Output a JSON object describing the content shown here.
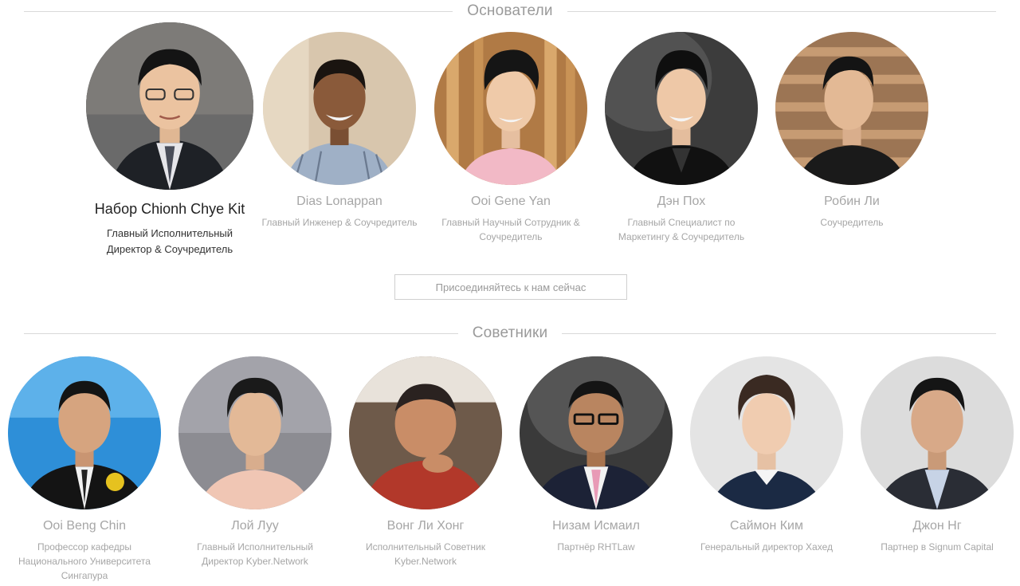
{
  "sections": {
    "founders_title": "Основатели",
    "advisors_title": "Советники"
  },
  "founders": [
    {
      "name": "Набор Chionh Chye Kit",
      "role": "Главный Исполнительный Директор & Соучредитель"
    },
    {
      "name": "Dias Lonappan",
      "role": "Главный Инженер & Соучредитель"
    },
    {
      "name": "Ooi Gene Yan",
      "role": "Главный Научный Сотрудник & Соучредитель"
    },
    {
      "name": "Дэн Пох",
      "role": "Главный Специалист по Маркетингу & Соучредитель"
    },
    {
      "name": "Робин Ли",
      "role": "Соучредитель"
    }
  ],
  "join_button": "Присоединяйтесь к нам сейчас",
  "advisors": [
    {
      "name": "Ooi Beng Chin",
      "role": "Профессор кафедры Национального Университета Сингапура"
    },
    {
      "name": "Лой Луу",
      "role": "Главный Исполнительный Директор Kyber.Network"
    },
    {
      "name": "Вонг Ли Хонг",
      "role": "Исполнительный Советник Kyber.Network"
    },
    {
      "name": "Низам Исмаил",
      "role": "Партнёр RHTLaw"
    },
    {
      "name": "Саймон Ким",
      "role": "Генеральный директор Хахед"
    },
    {
      "name": "Джон Нг",
      "role": "Партнер в Signum Capital"
    }
  ]
}
